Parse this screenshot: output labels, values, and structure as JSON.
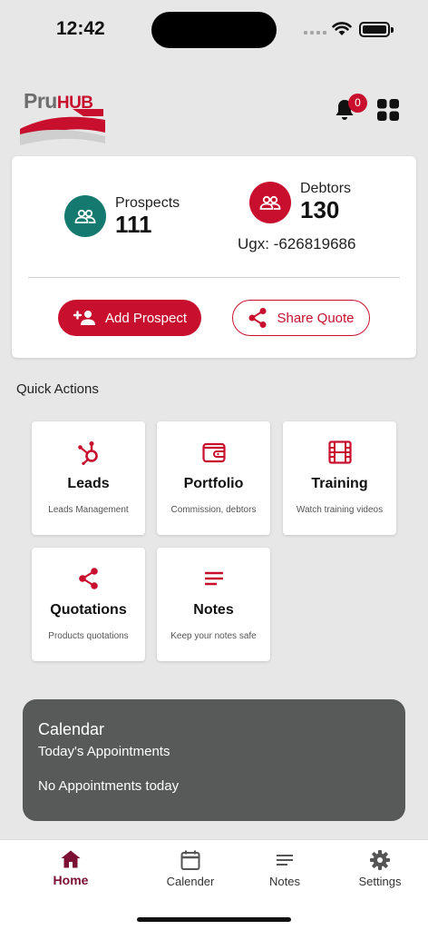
{
  "status_bar": {
    "time": "12:42"
  },
  "header": {
    "logo_text_pru": "Pru",
    "logo_text_hub": "HUB",
    "notification_count": "0",
    "icons": {
      "notifications": "bell-icon",
      "menu": "apps-grid-icon"
    }
  },
  "summary": {
    "prospects_label": "Prospects",
    "prospects_value": "111",
    "debtors_label": "Debtors",
    "debtors_value": "130",
    "balance": "Ugx: -626819686",
    "add_prospect_label": "Add Prospect",
    "share_quote_label": "Share Quote"
  },
  "quick_actions": {
    "title": "Quick Actions",
    "items": [
      {
        "title": "Leads",
        "subtitle": "Leads Management",
        "icon": "hubspot-icon"
      },
      {
        "title": "Portfolio",
        "subtitle": "Commission, debtors",
        "icon": "wallet-icon"
      },
      {
        "title": "Training",
        "subtitle": "Watch training videos",
        "icon": "film-icon"
      },
      {
        "title": "Quotations",
        "subtitle": "Products quotations",
        "icon": "share-icon"
      },
      {
        "title": "Notes",
        "subtitle": "Keep your notes safe",
        "icon": "notes-icon"
      }
    ]
  },
  "calendar": {
    "title": "Calendar",
    "subtitle": "Today's Appointments",
    "empty_text": "No Appointments today"
  },
  "bottom_nav": {
    "items": [
      {
        "label": "Home",
        "icon": "home-icon",
        "active": true
      },
      {
        "label": "Calender",
        "icon": "calendar-icon",
        "active": false
      },
      {
        "label": "Notes",
        "icon": "notes-icon",
        "active": false
      },
      {
        "label": "Settings",
        "icon": "gear-icon",
        "active": false
      }
    ]
  },
  "colors": {
    "brand_red": "#c8102e",
    "prospects_green": "#147a6f",
    "active_nav": "#7b1034",
    "calendar_bg": "#585a59",
    "page_bg": "#e7e7e7"
  }
}
